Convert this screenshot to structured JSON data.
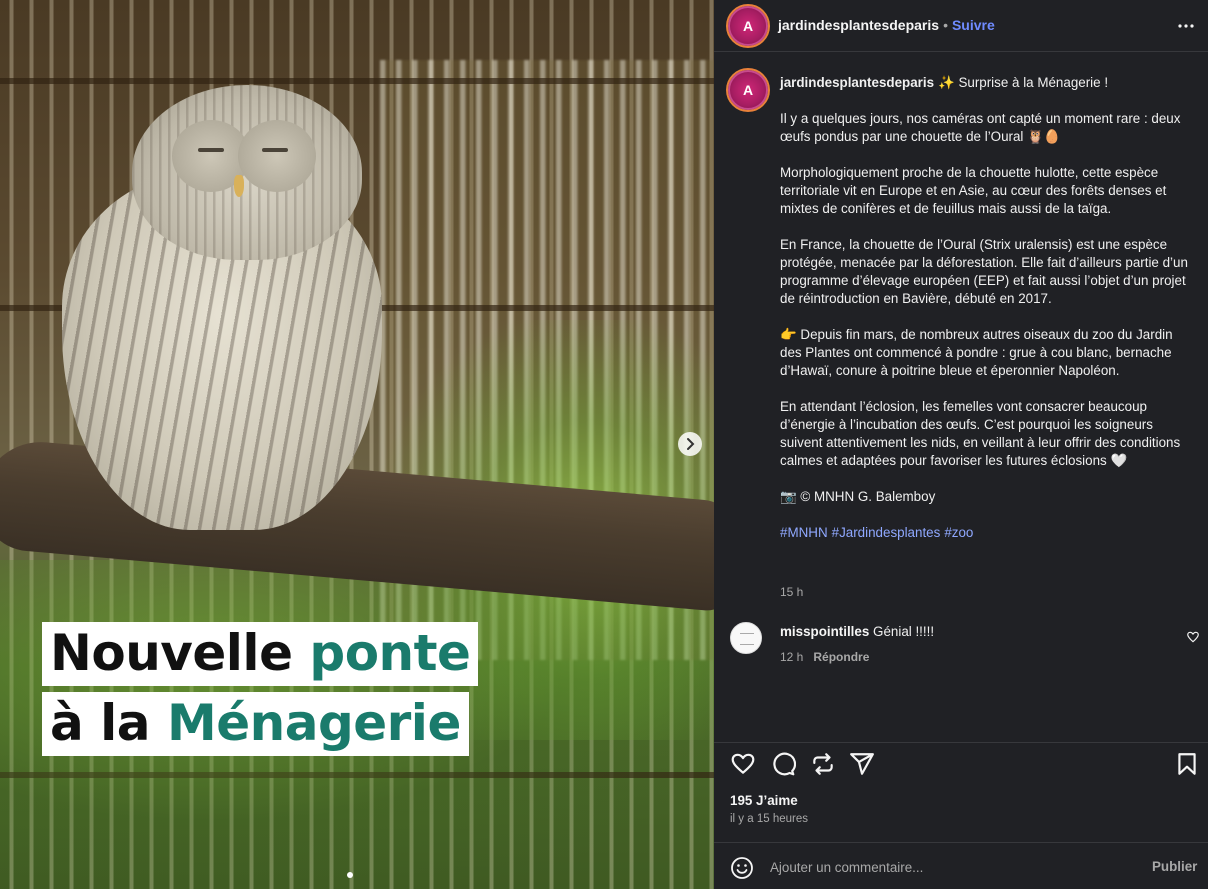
{
  "post": {
    "image": {
      "headline_line1_dark": "Nouvelle ",
      "headline_line1_accent": "ponte",
      "headline_line2_dark": "à la ",
      "headline_line2_accent": "Ménagerie",
      "accent_color": "#1a7b6c",
      "next_icon": "chevron-right-icon",
      "carousel_index": 1
    },
    "header": {
      "username": "jardindesplantesdeparis",
      "separator": "•",
      "follow_label": "Suivre",
      "more_icon": "more-horizontal-icon"
    },
    "caption": {
      "username": "jardindesplantesdeparis",
      "paragraphs": [
        "✨ Surprise à la Ménagerie !",
        "Il y a quelques jours, nos caméras ont capté un moment rare : deux œufs pondus par une chouette de l’Oural 🦉🥚",
        "Morphologiquement proche de la chouette hulotte, cette espèce territoriale vit en Europe et en Asie, au cœur des forêts denses et mixtes de conifères et de feuillus mais aussi de la taïga.",
        "En France, la chouette de l’Oural (Strix uralensis) est une espèce protégée, menacée par la déforestation. Elle fait d’ailleurs partie d’un programme d’élevage européen (EEP) et fait aussi l’objet d’un projet de réintroduction en Bavière, débuté en 2017.",
        "👉 Depuis fin mars, de nombreux autres oiseaux du zoo du Jardin des Plantes ont commencé à pondre : grue à cou blanc, bernache d’Hawaï, conure à poitrine bleue et éperonnier Napoléon.",
        "En attendant l’éclosion, les femelles vont consacrer beaucoup d’énergie à l’incubation des œufs. C’est pourquoi les soigneurs suivent attentivement les nids, en veillant à leur offrir des conditions calmes et adaptées pour favoriser les futures éclosions 🤍",
        "📷 © MNHN G. Balemboy"
      ],
      "hashtags": [
        "#MNHN",
        "#Jardindesplantes",
        "#zoo"
      ],
      "time": "15 h"
    },
    "comments": [
      {
        "username": "misspointilles",
        "text": "Génial !!!!!",
        "time": "12 h",
        "reply_label": "Répondre"
      }
    ],
    "actions": {
      "like_icon": "heart-icon",
      "comment_icon": "comment-icon",
      "share_icon": "repost-icon",
      "send_icon": "send-icon",
      "save_icon": "bookmark-icon"
    },
    "likes_label": "195 J’aime",
    "time_ago": "il y a 15 heures",
    "comment_box": {
      "placeholder": "Ajouter un commentaire...",
      "publish_label": "Publier",
      "emoji_icon": "emoji-icon"
    }
  },
  "colors": {
    "panel_bg": "#202125",
    "link_blue": "#6f8bff",
    "hashtag_blue": "#8fa8ff",
    "muted_text": "#a8a8a8"
  }
}
